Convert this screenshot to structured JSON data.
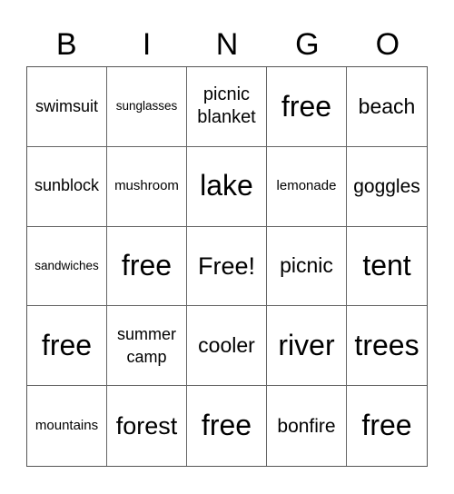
{
  "header": {
    "letters": [
      "B",
      "I",
      "N",
      "G",
      "O"
    ]
  },
  "board": {
    "rows": [
      [
        "swimsuit",
        "sunglasses",
        "picnic blanket",
        "free",
        "beach"
      ],
      [
        "sunblock",
        "mushroom",
        "lake",
        "lemonade",
        "goggles"
      ],
      [
        "sandwiches",
        "free",
        "Free!",
        "picnic",
        "tent"
      ],
      [
        "free",
        "summer camp",
        "cooler",
        "river",
        "trees"
      ],
      [
        "mountains",
        "forest",
        "free",
        "bonfire",
        "free"
      ]
    ]
  }
}
